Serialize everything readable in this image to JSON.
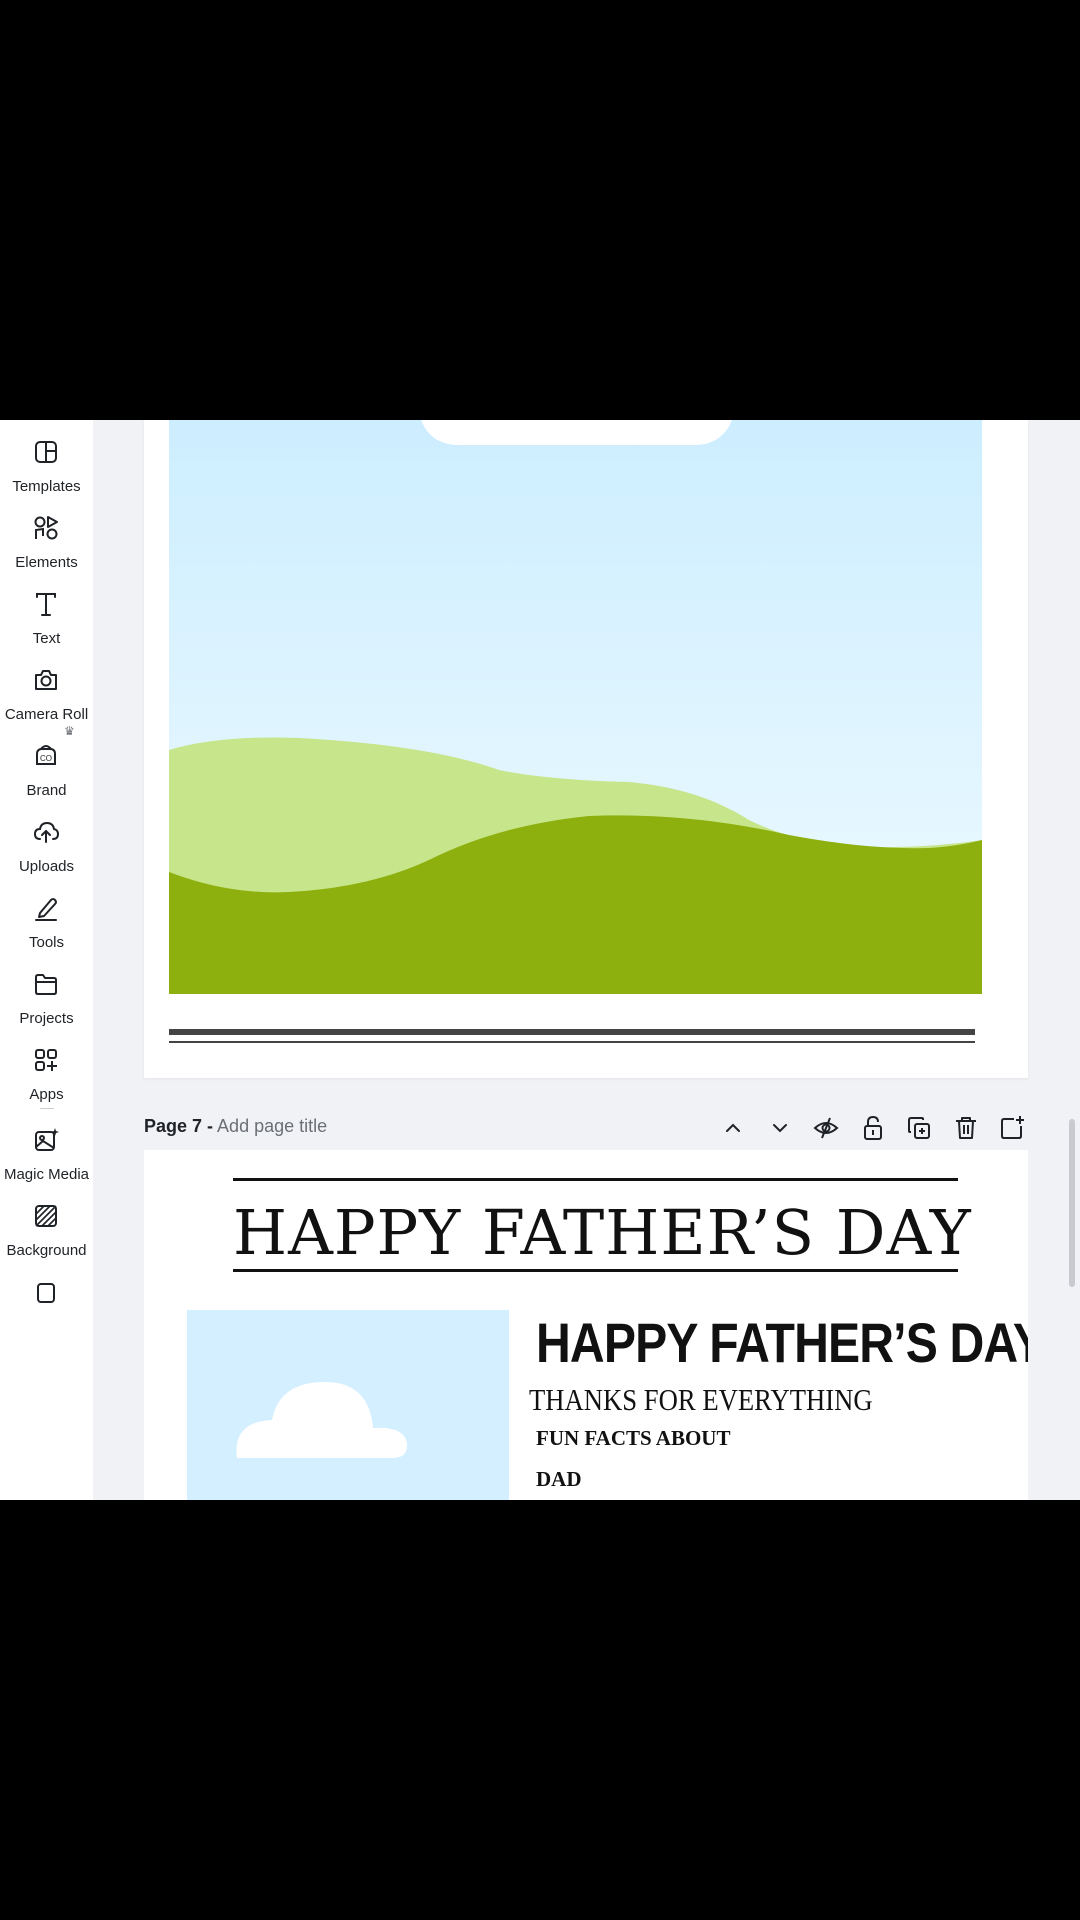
{
  "sidebar": {
    "items": [
      {
        "label": "Templates",
        "icon": "templates-icon"
      },
      {
        "label": "Elements",
        "icon": "elements-icon"
      },
      {
        "label": "Text",
        "icon": "text-icon"
      },
      {
        "label": "Camera Roll",
        "icon": "camera-icon"
      },
      {
        "label": "Brand",
        "icon": "brand-icon",
        "badge": "crown-icon"
      },
      {
        "label": "Uploads",
        "icon": "upload-cloud-icon"
      },
      {
        "label": "Tools",
        "icon": "pen-tool-icon"
      },
      {
        "label": "Projects",
        "icon": "folder-icon"
      },
      {
        "label": "Apps",
        "icon": "apps-grid-icon"
      },
      {
        "label": "Magic Media",
        "icon": "magic-media-icon"
      },
      {
        "label": "Background",
        "icon": "background-hatch-icon"
      }
    ]
  },
  "page_toolbar": {
    "page_number": "Page 7 -",
    "page_title_placeholder": "Add page title",
    "tools": [
      "move-up-icon",
      "move-down-icon",
      "hide-page-icon",
      "lock-icon",
      "duplicate-page-icon",
      "delete-page-icon",
      "add-page-icon"
    ]
  },
  "page7": {
    "heading": "HAPPY FATHER’S DAY",
    "subheading": "HAPPY FATHER’S DAY",
    "tagline": "THANKS FOR EVERYTHING",
    "facts_title": "FUN FACTS ABOUT",
    "facts_subject": "DAD"
  },
  "colors": {
    "sky_top": "#cdeeff",
    "sky_bottom": "#eefaff",
    "hill_light": "#c7e58a",
    "hill_dark": "#8db00f",
    "canvas_bg": "#f1f2f6"
  }
}
